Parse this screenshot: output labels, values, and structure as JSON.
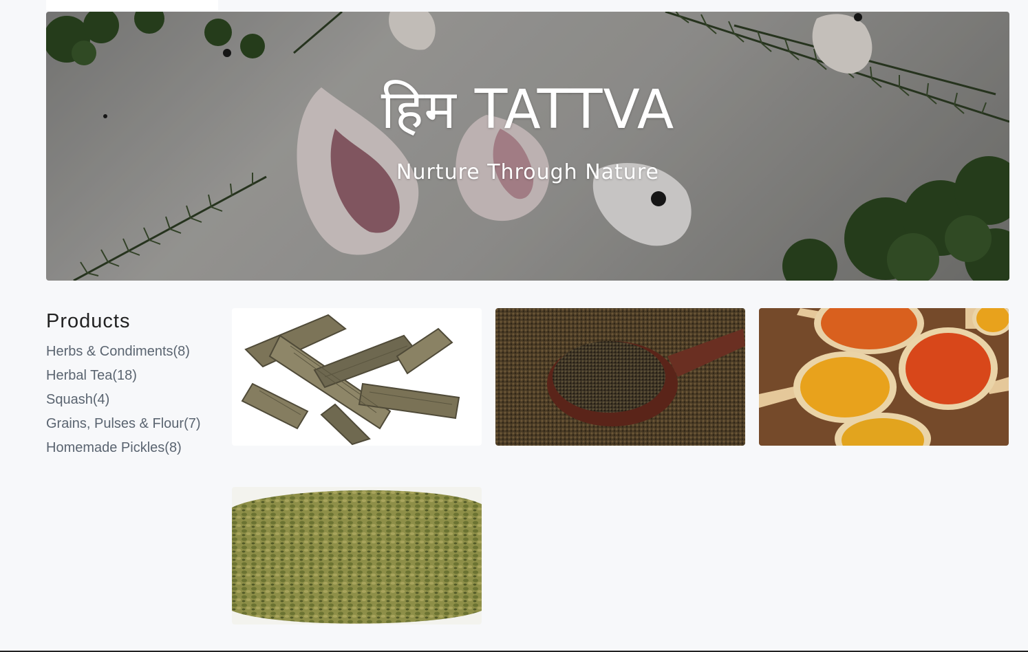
{
  "hero": {
    "title": "हिम TATTVA",
    "subtitle": "Nurture Through Nature"
  },
  "sidebar": {
    "heading": "Products",
    "categories": [
      {
        "label": "Herbs & Condiments(8)"
      },
      {
        "label": "Herbal Tea(18)"
      },
      {
        "label": "Squash(4)"
      },
      {
        "label": "Grains, Pulses & Flour(7)"
      },
      {
        "label": "Homemade Pickles(8)"
      }
    ]
  },
  "products": [
    {
      "image": "dried-roots"
    },
    {
      "image": "seeds-in-wooden-spoon"
    },
    {
      "image": "spice-powders-in-spoons"
    },
    {
      "image": "dried-leaves"
    }
  ]
}
